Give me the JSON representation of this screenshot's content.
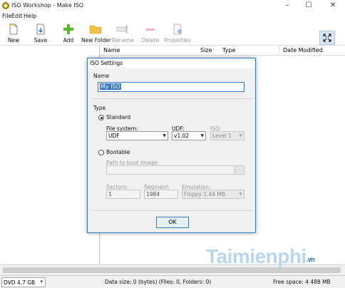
{
  "window": {
    "title": "ISO Workshop - Make ISO"
  },
  "menu": [
    "File",
    "Edit",
    "Help"
  ],
  "toolbar": {
    "new": "New",
    "save": "Save",
    "add": "Add",
    "new_folder": "New Folder",
    "rename": "Rename",
    "delete": "Delete",
    "properties": "Properties"
  },
  "list": {
    "columns": {
      "name": "Name",
      "size": "Size",
      "type": "Type",
      "date": "Date Modified"
    }
  },
  "dialog": {
    "title": "ISO Settings",
    "name_label": "Name",
    "name_value": "My ISO",
    "type_label": "Type",
    "standard_label": "Standard",
    "file_system_label": "File system:",
    "file_system_value": "UDF",
    "udf_label": "UDF:",
    "udf_value": "v1.02",
    "iso_label": "ISO:",
    "iso_value": "Level 1",
    "bootable_label": "Bootable",
    "boot_path_label": "Path to boot image:",
    "boot_path_value": "",
    "sectors_label": "Sectors:",
    "sectors_value": "1",
    "segment_label": "Segment:",
    "segment_value": "1984",
    "emulation_label": "Emulation:",
    "emulation_value": "Floppy 1.44 MB",
    "ok": "OK"
  },
  "status": {
    "disk": "DVD 4.7 GB",
    "data_size": "Data size: 0 (bytes) (Files: 0, Folders: 0)",
    "free_space": "Free space: 4 488 MB"
  },
  "watermark": {
    "text": "Taimienphi",
    "suffix": ".vn"
  },
  "colors": {
    "accent": "#3a7ac4",
    "selection": "#3477c8",
    "add_green": "#5cb82e",
    "folder_yellow": "#f0c24a"
  }
}
